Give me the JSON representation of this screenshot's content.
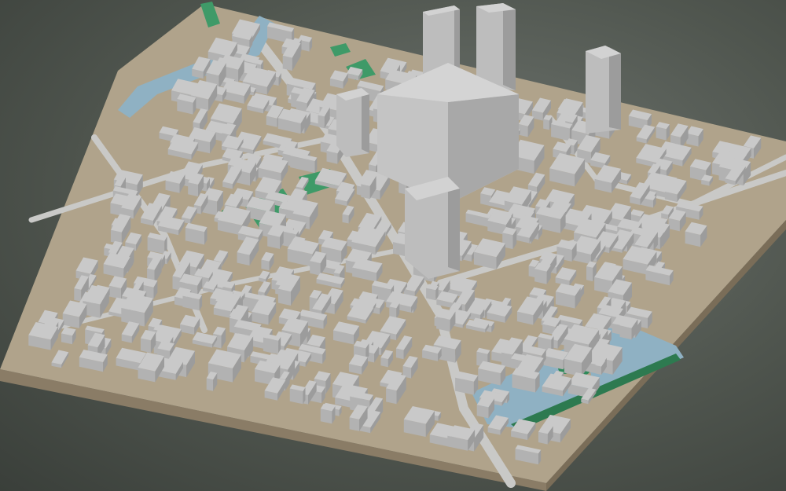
{
  "scene": {
    "kind": "3d-city-block-model",
    "colors": {
      "background": "#555a54",
      "base_top": "#a79b86",
      "base_side_front": "#8a7c66",
      "base_side_right": "#7a6d58",
      "ground": "#b6a98f",
      "road": "#c6c6c4",
      "water": "#8fb1c3",
      "park": "#3f9a68",
      "park_dark": "#2d7a50",
      "building_roof": "#c9c9c9",
      "building_left_wall": "#b2b2b2",
      "building_right_wall": "#9c9c9c",
      "tower_roof": "#d2d2d2"
    },
    "features": {
      "tall_towers": 6,
      "water_bodies": [
        "canal",
        "basin"
      ],
      "parks": 6,
      "island_with_trees": true
    }
  }
}
